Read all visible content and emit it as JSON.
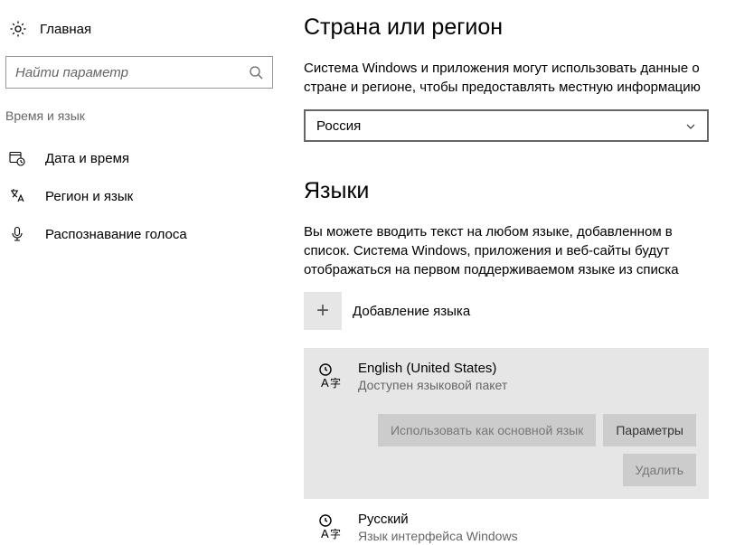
{
  "sidebar": {
    "home_label": "Главная",
    "search_placeholder": "Найти параметр",
    "section_title": "Время и язык",
    "items": [
      {
        "label": "Дата и время"
      },
      {
        "label": "Регион и язык"
      },
      {
        "label": "Распознавание голоса"
      }
    ]
  },
  "main": {
    "region": {
      "heading": "Страна или регион",
      "description": "Система Windows и приложения могут использовать данные о стране и регионе, чтобы предоставлять местную информацию",
      "selected": "Россия"
    },
    "languages": {
      "heading": "Языки",
      "description": "Вы можете вводить текст на любом языке, добавленном в список. Система Windows, приложения и веб-сайты будут отображаться на первом поддерживаемом языке из списка",
      "add_label": "Добавление языка",
      "items": [
        {
          "name": "English (United States)",
          "subtitle": "Доступен языковой пакет",
          "buttons": {
            "set_default": "Использовать как основной язык",
            "options": "Параметры",
            "remove": "Удалить"
          }
        },
        {
          "name": "Русский",
          "subtitle": "Язык интерфейса Windows"
        }
      ]
    }
  }
}
